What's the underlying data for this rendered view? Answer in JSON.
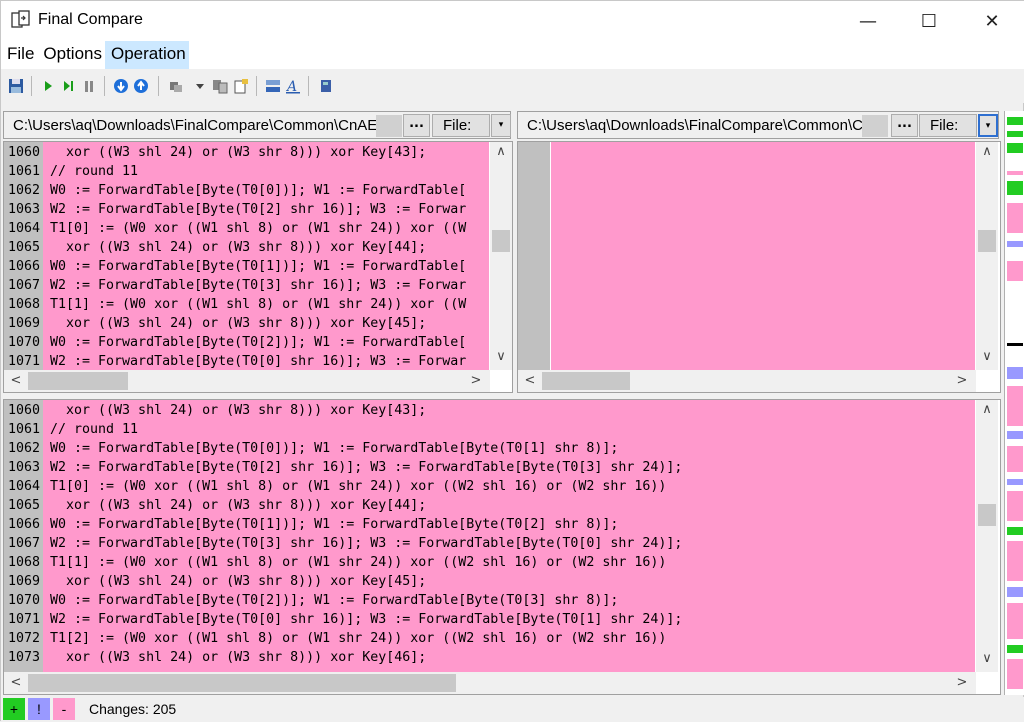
{
  "window": {
    "title": "Final Compare",
    "controls": {
      "minimize": "—",
      "maximize": "☐",
      "close": "✕"
    }
  },
  "menu": [
    {
      "label": "File"
    },
    {
      "label": "Options"
    },
    {
      "label": "Operation"
    }
  ],
  "toolbar": {
    "icons": [
      "save-icon",
      "play-icon",
      "step-icon",
      "pause-icon",
      "previous-diff-icon",
      "next-diff-icon",
      "settings-icon",
      "dropdown-icon",
      "copy-icon",
      "paste-icon",
      "split-horizontal-icon",
      "font-icon",
      "book-icon"
    ]
  },
  "left_path": {
    "path": "C:\\Users\\aq\\Downloads\\FinalCompare\\Common\\CnAE",
    "dots": "...",
    "file_label": "File:",
    "drop": "▾"
  },
  "right_path": {
    "path": "C:\\Users\\aq\\Downloads\\FinalCompare\\Common\\C",
    "dots": "...",
    "file_label": "File:",
    "drop": "▾"
  },
  "left_pane": {
    "lines": [
      {
        "n": "1060",
        "code": "  xor ((W3 shl 24) or (W3 shr 8))) xor Key[43];"
      },
      {
        "n": "1061",
        "code": "// round 11"
      },
      {
        "n": "1062",
        "code": "W0 := ForwardTable[Byte(T0[0])]; W1 := ForwardTable["
      },
      {
        "n": "1063",
        "code": "W2 := ForwardTable[Byte(T0[2] shr 16)]; W3 := Forwar"
      },
      {
        "n": "1064",
        "code": "T1[0] := (W0 xor ((W1 shl 8) or (W1 shr 24)) xor ((W"
      },
      {
        "n": "1065",
        "code": "  xor ((W3 shl 24) or (W3 shr 8))) xor Key[44];"
      },
      {
        "n": "1066",
        "code": "W0 := ForwardTable[Byte(T0[1])]; W1 := ForwardTable["
      },
      {
        "n": "1067",
        "code": "W2 := ForwardTable[Byte(T0[3] shr 16)]; W3 := Forwar"
      },
      {
        "n": "1068",
        "code": "T1[1] := (W0 xor ((W1 shl 8) or (W1 shr 24)) xor ((W"
      },
      {
        "n": "1069",
        "code": "  xor ((W3 shl 24) or (W3 shr 8))) xor Key[45];"
      },
      {
        "n": "1070",
        "code": "W0 := ForwardTable[Byte(T0[2])]; W1 := ForwardTable["
      },
      {
        "n": "1071",
        "code": "W2 := ForwardTable[Byte(T0[0] shr 16)]; W3 := Forwar"
      }
    ]
  },
  "bottom_pane": {
    "lines": [
      {
        "n": "1060",
        "code": "  xor ((W3 shl 24) or (W3 shr 8))) xor Key[43];"
      },
      {
        "n": "1061",
        "code": "// round 11"
      },
      {
        "n": "1062",
        "code": "W0 := ForwardTable[Byte(T0[0])]; W1 := ForwardTable[Byte(T0[1] shr 8)];"
      },
      {
        "n": "1063",
        "code": "W2 := ForwardTable[Byte(T0[2] shr 16)]; W3 := ForwardTable[Byte(T0[3] shr 24)];"
      },
      {
        "n": "1064",
        "code": "T1[0] := (W0 xor ((W1 shl 8) or (W1 shr 24)) xor ((W2 shl 16) or (W2 shr 16))"
      },
      {
        "n": "1065",
        "code": "  xor ((W3 shl 24) or (W3 shr 8))) xor Key[44];"
      },
      {
        "n": "1066",
        "code": "W0 := ForwardTable[Byte(T0[1])]; W1 := ForwardTable[Byte(T0[2] shr 8)];"
      },
      {
        "n": "1067",
        "code": "W2 := ForwardTable[Byte(T0[3] shr 16)]; W3 := ForwardTable[Byte(T0[0] shr 24)];"
      },
      {
        "n": "1068",
        "code": "T1[1] := (W0 xor ((W1 shl 8) or (W1 shr 24)) xor ((W2 shl 16) or (W2 shr 16))"
      },
      {
        "n": "1069",
        "code": "  xor ((W3 shl 24) or (W3 shr 8))) xor Key[45];"
      },
      {
        "n": "1070",
        "code": "W0 := ForwardTable[Byte(T0[2])]; W1 := ForwardTable[Byte(T0[3] shr 8)];"
      },
      {
        "n": "1071",
        "code": "W2 := ForwardTable[Byte(T0[0] shr 16)]; W3 := ForwardTable[Byte(T0[1] shr 24)];"
      },
      {
        "n": "1072",
        "code": "T1[2] := (W0 xor ((W1 shl 8) or (W1 shr 24)) xor ((W2 shl 16) or (W2 shr 16))"
      },
      {
        "n": "1073",
        "code": "  xor ((W3 shl 24) or (W3 shr 8))) xor Key[46];"
      }
    ]
  },
  "status": {
    "added_label": "+",
    "changed_label": "!",
    "removed_label": "-",
    "changes_text": "Changes: 205"
  },
  "colors": {
    "diff_pink": "#ff99cc",
    "added_green": "#22cc22",
    "changed_blue": "#9999ff",
    "gutter_gray": "#c0c0c0"
  }
}
